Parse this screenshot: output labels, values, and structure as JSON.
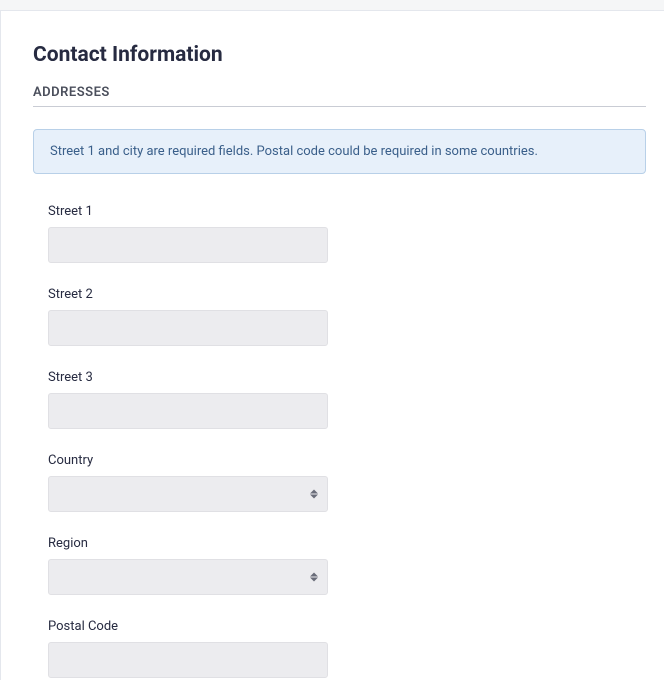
{
  "section": {
    "title": "Contact Information",
    "subsection": "ADDRESSES"
  },
  "banner": {
    "message": "Street 1 and city are required fields. Postal code could be required in some countries."
  },
  "form": {
    "street1": {
      "label": "Street 1",
      "value": ""
    },
    "street2": {
      "label": "Street 2",
      "value": ""
    },
    "street3": {
      "label": "Street 3",
      "value": ""
    },
    "country": {
      "label": "Country",
      "value": ""
    },
    "region": {
      "label": "Region",
      "value": ""
    },
    "postalCode": {
      "label": "Postal Code",
      "value": ""
    }
  }
}
